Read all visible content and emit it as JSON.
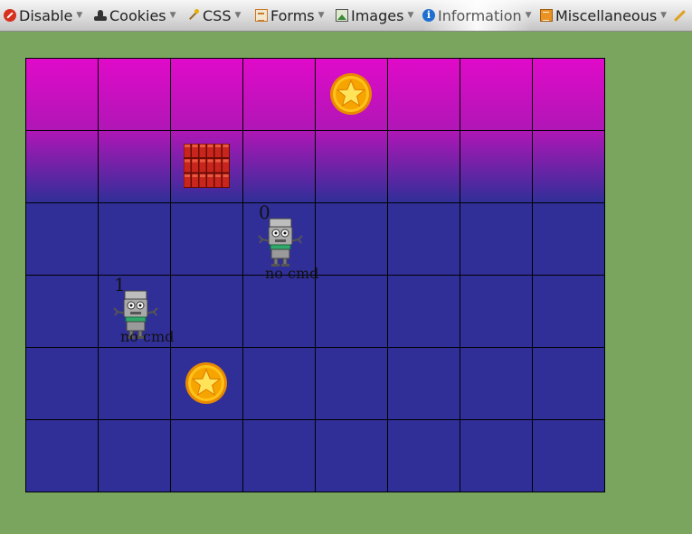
{
  "toolbar": {
    "items": [
      {
        "label": "Disable",
        "icon": "disable-icon"
      },
      {
        "label": "Cookies",
        "icon": "cookies-icon"
      },
      {
        "label": "CSS",
        "icon": "css-icon"
      },
      {
        "label": "Forms",
        "icon": "forms-icon"
      },
      {
        "label": "Images",
        "icon": "images-icon"
      },
      {
        "label": "Information",
        "icon": "information-icon"
      },
      {
        "label": "Miscellaneous",
        "icon": "miscellaneous-icon"
      }
    ],
    "dropdown_glyph": "▼"
  },
  "board": {
    "columns": 8,
    "rows": 6,
    "colors": {
      "top": "#e10ac9",
      "bottom": "#302f98",
      "page_background": "#7aa55f",
      "grid_lines": "#000000"
    },
    "coins": [
      {
        "col": 4,
        "row": 0
      },
      {
        "col": 2,
        "row": 4
      }
    ],
    "bricks": [
      {
        "col": 2,
        "row": 1
      }
    ],
    "robots": [
      {
        "id": "0",
        "status": "no cmd",
        "col": 3,
        "row": 2
      },
      {
        "id": "1",
        "status": "no cmd",
        "col": 1,
        "row": 3
      }
    ]
  }
}
